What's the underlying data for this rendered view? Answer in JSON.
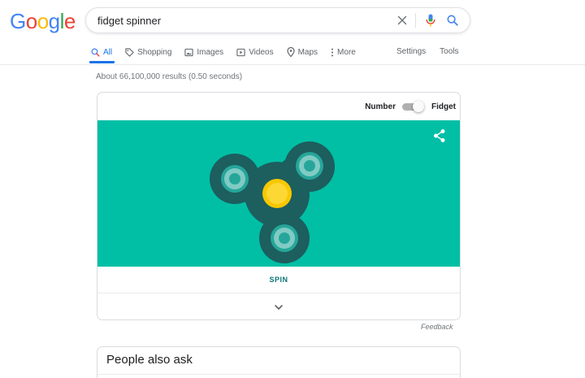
{
  "logo": {
    "letters": [
      {
        "ch": "G",
        "color": "#4285F4"
      },
      {
        "ch": "o",
        "color": "#EA4335"
      },
      {
        "ch": "o",
        "color": "#FBBC05"
      },
      {
        "ch": "g",
        "color": "#4285F4"
      },
      {
        "ch": "l",
        "color": "#34A853"
      },
      {
        "ch": "e",
        "color": "#EA4335"
      }
    ]
  },
  "search": {
    "query": "fidget spinner",
    "clear_icon": "close-icon",
    "mic_icon": "microphone-icon",
    "search_icon": "search-icon"
  },
  "tabs": [
    {
      "label": "All",
      "icon": "search-icon",
      "active": true
    },
    {
      "label": "Shopping",
      "icon": "tag-icon",
      "active": false
    },
    {
      "label": "Images",
      "icon": "image-icon",
      "active": false
    },
    {
      "label": "Videos",
      "icon": "play-icon",
      "active": false
    },
    {
      "label": "Maps",
      "icon": "map-pin-icon",
      "active": false
    },
    {
      "label": "More",
      "icon": "more-vertical-icon",
      "active": false
    }
  ],
  "tools": {
    "settings": "Settings",
    "tools": "Tools"
  },
  "results_stats": "About 66,100,000 results (0.50 seconds)",
  "spinner_card": {
    "mode_left": "Number",
    "mode_right": "Fidget",
    "toggle_on": true,
    "spin_label": "SPIN",
    "share_icon": "share-icon",
    "expand_icon": "chevron-down-icon",
    "colors": {
      "background": "#00bfa5",
      "body": "#1d5e5e",
      "bearing_ring": "#26a69a",
      "bearing_inner": "#80cbc4",
      "bearing_center": "#26a69a",
      "cap_outer": "#f9c800",
      "cap_inner": "#fdd835"
    }
  },
  "feedback": "Feedback",
  "people_also_ask": {
    "title": "People also ask"
  }
}
